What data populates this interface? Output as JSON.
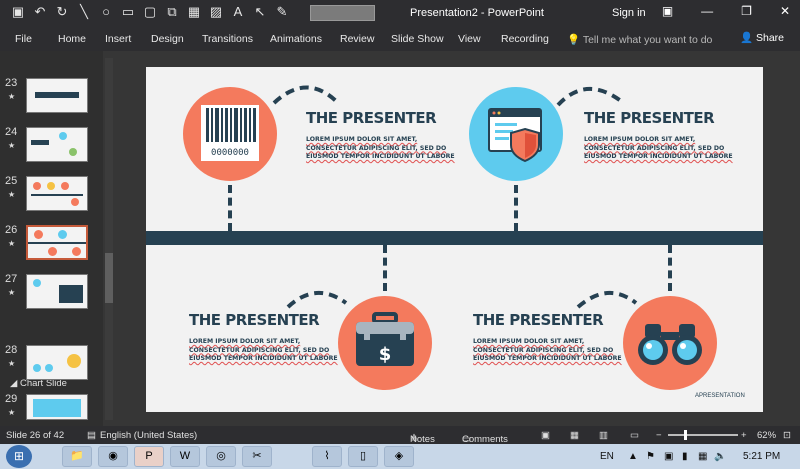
{
  "window": {
    "title": "Presentation2 - PowerPoint",
    "sign_in": "Sign in",
    "share": "Share",
    "tell_me": "Tell me what you want to do"
  },
  "ribbon_tabs": [
    "File",
    "Home",
    "Insert",
    "Design",
    "Transitions",
    "Animations",
    "Review",
    "Slide Show",
    "View",
    "Recording"
  ],
  "thumbnails": [
    {
      "num": "23",
      "selected": false
    },
    {
      "num": "24",
      "selected": false
    },
    {
      "num": "25",
      "selected": false
    },
    {
      "num": "26",
      "selected": true
    },
    {
      "num": "27",
      "selected": false
    },
    {
      "num": "28",
      "selected": false
    },
    {
      "num": "29",
      "selected": false
    }
  ],
  "section": {
    "label": "Chart Slide"
  },
  "slide": {
    "blocks": [
      {
        "heading": "THE PRESENTER",
        "body": "LOREM IPSUM DOLOR SIT AMET, CONSECTETUR ADIPISCING ELIT, SED DO EIUSMOD TEMPOR INCIDIDUNT UT LABORE",
        "icon": "barcode-icon",
        "color": "#f47a5d"
      },
      {
        "heading": "THE PRESENTER",
        "body": "LOREM IPSUM DOLOR SIT AMET, CONSECTETUR ADIPISCING ELIT, SED DO EIUSMOD TEMPOR INCIDIDUNT UT LABORE",
        "icon": "security-window-icon",
        "color": "#5ecbee"
      },
      {
        "heading": "THE PRESENTER",
        "body": "LOREM IPSUM DOLOR SIT AMET, CONSECTETUR ADIPISCING ELIT, SED DO EIUSMOD TEMPOR INCIDIDUNT UT LABORE",
        "icon": "briefcase-dollar-icon",
        "color": "#f47a5d"
      },
      {
        "heading": "THE PRESENTER",
        "body": "LOREM IPSUM DOLOR SIT AMET, CONSECTETUR ADIPISCING ELIT, SED DO EIUSMOD TEMPOR INCIDIDUNT UT LABORE",
        "icon": "binoculars-icon",
        "color": "#f47a5d"
      }
    ],
    "watermark": "APRESENTATION",
    "barcode_digits": "0000000"
  },
  "status": {
    "slide_info": "Slide 26 of 42",
    "language": "English (United States)",
    "notes": "Notes",
    "comments": "Comments",
    "zoom": "62%"
  },
  "taskbar": {
    "lang": "EN",
    "time": "5:21 PM"
  },
  "colors": {
    "navy": "#264152",
    "orange": "#f47a5d",
    "cyan": "#5ecbee"
  }
}
